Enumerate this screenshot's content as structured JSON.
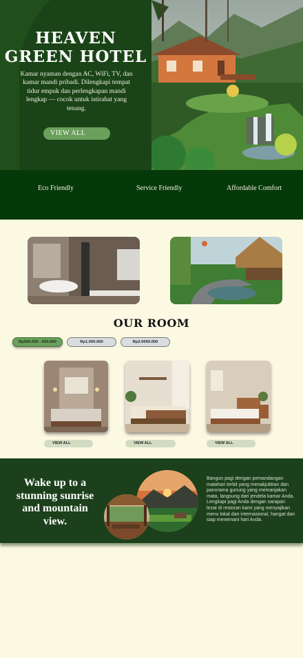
{
  "hero": {
    "title": "HEAVEN GREEN HOTEL",
    "description": "Kamar nyaman dengan AC, WiFi, TV, dan kamar mandi pribadi. Dilengkapi tempat tidur empuk dan perlengkapan mandi lengkap — cocok untuk istirahat yang tenang.",
    "button_label": "VIEW ALL"
  },
  "features": [
    "Eco Friendly",
    "Service Friendly",
    "Affordable Comfort"
  ],
  "rooms_section": {
    "title": "OUR ROOM",
    "price_filters": [
      {
        "label": "Rp500.000 - 600.000",
        "active": true
      },
      {
        "label": "Rp1.000.000",
        "active": false
      },
      {
        "label": "Rp2.0000.000",
        "active": false
      }
    ],
    "view_all_label": "VIEW ALL"
  },
  "sunrise": {
    "title": "Wake up to a stunning sunrise and mountain view.",
    "description": "Bangun pagi dengan pemandangan matahari terbit yang menakjubkan dan panorama gunung yang memanjakan mata, langsung dari jendela kamar Anda. Lengkapi pagi Anda dengan sarapan lezat di restoran kami yang menyajikan menu lokal dan internasional, hangat dan siap menemani hari Anda."
  },
  "colors": {
    "dark_green": "#1d4a1b",
    "band_green": "#063909",
    "accent_green": "#6aa05c",
    "cream": "#fcf9e3"
  }
}
